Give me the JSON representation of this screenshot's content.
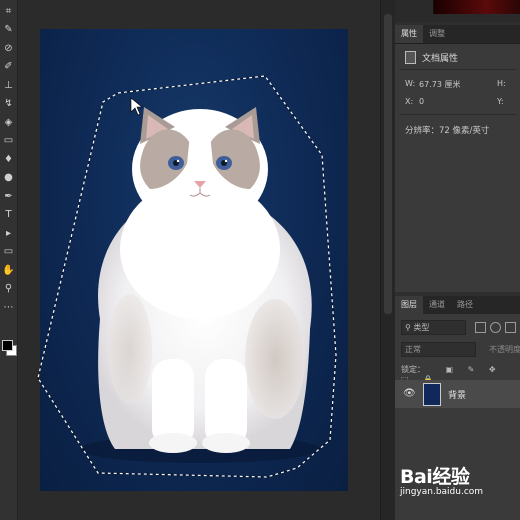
{
  "toolbar": {
    "tools": [
      {
        "icon": "crop-icon",
        "glyph": "⌗"
      },
      {
        "icon": "eyedropper-icon",
        "glyph": "✎"
      },
      {
        "icon": "spot-healing-icon",
        "glyph": "⊘"
      },
      {
        "icon": "brush-icon",
        "glyph": "✐"
      },
      {
        "icon": "stamp-icon",
        "glyph": "⊥"
      },
      {
        "icon": "history-brush-icon",
        "glyph": "↯"
      },
      {
        "icon": "eraser-icon",
        "glyph": "◈"
      },
      {
        "icon": "gradient-icon",
        "glyph": "▭"
      },
      {
        "icon": "blur-icon",
        "glyph": "♦"
      },
      {
        "icon": "dodge-icon",
        "glyph": "●"
      },
      {
        "icon": "pen-icon",
        "glyph": "✒"
      },
      {
        "icon": "type-icon",
        "glyph": "T"
      },
      {
        "icon": "path-select-icon",
        "glyph": "▸"
      },
      {
        "icon": "rectangle-icon",
        "glyph": "▭"
      },
      {
        "icon": "hand-icon",
        "glyph": "✋"
      },
      {
        "icon": "zoom-icon",
        "glyph": "⚲"
      },
      {
        "icon": "more-tools-icon",
        "glyph": "⋯"
      }
    ]
  },
  "properties_panel": {
    "tabs": [
      "属性",
      "调整"
    ],
    "title": "文档属性",
    "w_label": "W:",
    "w_value": "67.73 厘米",
    "h_label": "H:",
    "x_label": "X:",
    "x_value": "0",
    "y_label": "Y:",
    "resolution": "分辨率：72 像素/英寸"
  },
  "layers_panel": {
    "tabs": [
      "图层",
      "通道",
      "路径"
    ],
    "filter": "类型",
    "blend_mode": "正常",
    "opacity_label": "不透明度",
    "lock_label": "锁定：",
    "layer_name": "背景"
  },
  "watermark": {
    "logo": "Bai经验",
    "url": "jingyan.baidu.com"
  },
  "colors": {
    "photo_background": "#0f2b57",
    "panel_bg": "#3a3a3a",
    "app_bg": "#2b2b2b"
  }
}
